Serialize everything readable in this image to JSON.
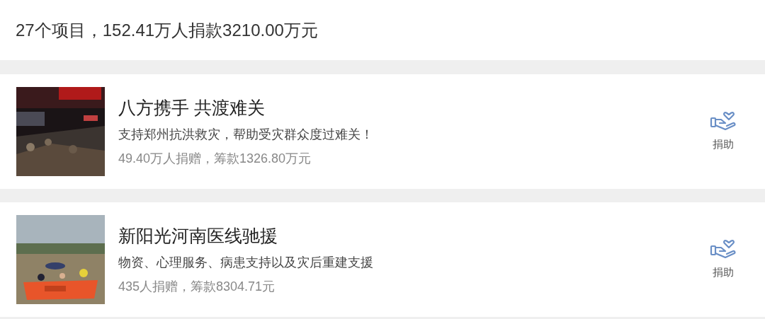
{
  "summary": "27个项目，152.41万人捐款3210.00万元",
  "projects": [
    {
      "title": "八方携手 共渡难关",
      "description": "支持郑州抗洪救灾，帮助受灾群众度过难关！",
      "stats": "49.40万人捐赠，筹款1326.80万元",
      "button": "捐助"
    },
    {
      "title": "新阳光河南医线驰援",
      "description": "物资、心理服务、病患支持以及灾后重建支援",
      "stats": "435人捐赠，筹款8304.71元",
      "button": "捐助"
    }
  ]
}
